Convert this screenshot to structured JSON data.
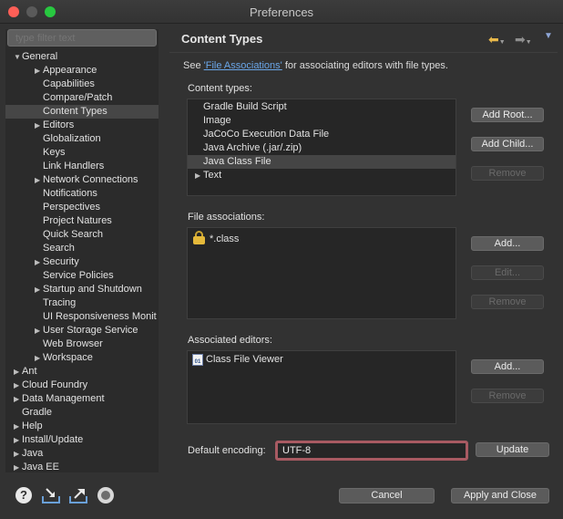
{
  "window": {
    "title": "Preferences"
  },
  "sidebar": {
    "filter_placeholder": "type filter text",
    "items": [
      {
        "label": "General",
        "indent": 0,
        "arrow": "expanded"
      },
      {
        "label": "Appearance",
        "indent": 1,
        "arrow": "collapsed"
      },
      {
        "label": "Capabilities",
        "indent": 1,
        "arrow": "none"
      },
      {
        "label": "Compare/Patch",
        "indent": 1,
        "arrow": "none"
      },
      {
        "label": "Content Types",
        "indent": 1,
        "arrow": "none",
        "selected": true
      },
      {
        "label": "Editors",
        "indent": 1,
        "arrow": "collapsed"
      },
      {
        "label": "Globalization",
        "indent": 1,
        "arrow": "none"
      },
      {
        "label": "Keys",
        "indent": 1,
        "arrow": "none"
      },
      {
        "label": "Link Handlers",
        "indent": 1,
        "arrow": "none"
      },
      {
        "label": "Network Connections",
        "indent": 1,
        "arrow": "collapsed"
      },
      {
        "label": "Notifications",
        "indent": 1,
        "arrow": "none"
      },
      {
        "label": "Perspectives",
        "indent": 1,
        "arrow": "none"
      },
      {
        "label": "Project Natures",
        "indent": 1,
        "arrow": "none"
      },
      {
        "label": "Quick Search",
        "indent": 1,
        "arrow": "none"
      },
      {
        "label": "Search",
        "indent": 1,
        "arrow": "none"
      },
      {
        "label": "Security",
        "indent": 1,
        "arrow": "collapsed"
      },
      {
        "label": "Service Policies",
        "indent": 1,
        "arrow": "none"
      },
      {
        "label": "Startup and Shutdown",
        "indent": 1,
        "arrow": "collapsed"
      },
      {
        "label": "Tracing",
        "indent": 1,
        "arrow": "none"
      },
      {
        "label": "UI Responsiveness Monit",
        "indent": 1,
        "arrow": "none"
      },
      {
        "label": "User Storage Service",
        "indent": 1,
        "arrow": "collapsed"
      },
      {
        "label": "Web Browser",
        "indent": 1,
        "arrow": "none"
      },
      {
        "label": "Workspace",
        "indent": 1,
        "arrow": "collapsed"
      },
      {
        "label": "Ant",
        "indent": 0,
        "arrow": "collapsed"
      },
      {
        "label": "Cloud Foundry",
        "indent": 0,
        "arrow": "collapsed"
      },
      {
        "label": "Data Management",
        "indent": 0,
        "arrow": "collapsed"
      },
      {
        "label": "Gradle",
        "indent": 0,
        "arrow": "none"
      },
      {
        "label": "Help",
        "indent": 0,
        "arrow": "collapsed"
      },
      {
        "label": "Install/Update",
        "indent": 0,
        "arrow": "collapsed"
      },
      {
        "label": "Java",
        "indent": 0,
        "arrow": "collapsed"
      },
      {
        "label": "Java EE",
        "indent": 0,
        "arrow": "collapsed"
      }
    ]
  },
  "page": {
    "title": "Content Types",
    "nav_back_icon": "arrow-left-icon",
    "nav_forward_icon": "arrow-right-icon",
    "description_prefix": "See ",
    "description_link": "'File Associations'",
    "description_suffix": " for associating editors with file types.",
    "content_types": {
      "label": "Content types:",
      "items": [
        {
          "label": "Gradle Build Script",
          "arrow": false
        },
        {
          "label": "Image",
          "arrow": false
        },
        {
          "label": "JaCoCo Execution Data File",
          "arrow": false
        },
        {
          "label": "Java Archive (.jar/.zip)",
          "arrow": false
        },
        {
          "label": "Java Class File",
          "arrow": false,
          "selected": true
        },
        {
          "label": "Text",
          "arrow": true
        }
      ],
      "buttons": {
        "add_root": "Add Root...",
        "add_child": "Add Child...",
        "remove": "Remove"
      }
    },
    "file_associations": {
      "label": "File associations:",
      "items": [
        "*.class"
      ],
      "buttons": {
        "add": "Add...",
        "edit": "Edit...",
        "remove": "Remove"
      }
    },
    "associated_editors": {
      "label": "Associated editors:",
      "items": [
        "Class File Viewer"
      ],
      "buttons": {
        "add": "Add...",
        "remove": "Remove"
      }
    },
    "encoding": {
      "label": "Default encoding:",
      "value": "UTF-8",
      "update": "Update"
    }
  },
  "footer": {
    "help_glyph": "?",
    "cancel": "Cancel",
    "apply_close": "Apply and Close"
  },
  "colors": {
    "background": "#323232",
    "panel": "#2b2b2b",
    "link": "#6aa6e8",
    "focus_border": "#a85a62"
  }
}
